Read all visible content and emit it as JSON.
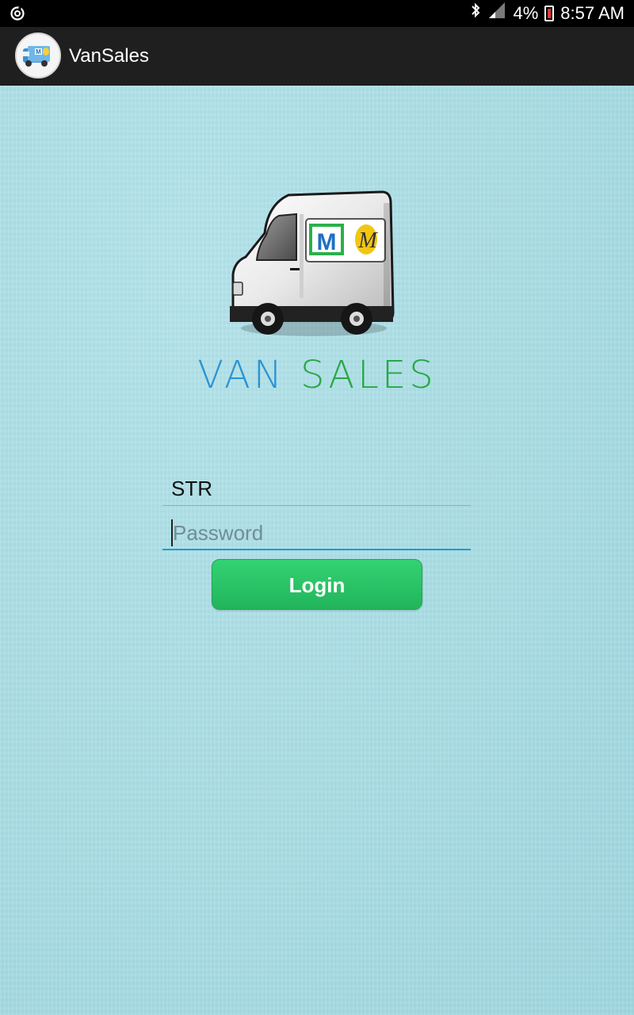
{
  "status_bar": {
    "battery_text": "4%",
    "time": "8:57 AM",
    "icons": [
      "sync-icon",
      "bluetooth-icon",
      "signal-icon",
      "battery-icon"
    ]
  },
  "app_bar": {
    "title": "VanSales",
    "icon": "van-app-icon"
  },
  "branding": {
    "word1": "VAN",
    "word2": "SALES",
    "colors": {
      "van": "#2b93d3",
      "sales": "#27a844"
    }
  },
  "login_form": {
    "username_value": "STR",
    "password_placeholder": "Password",
    "login_label": "Login"
  },
  "colors": {
    "background": "#a9dde4",
    "app_bar": "#1f1f1f",
    "accent": "#1f9bd1",
    "button": "#2ac666"
  }
}
